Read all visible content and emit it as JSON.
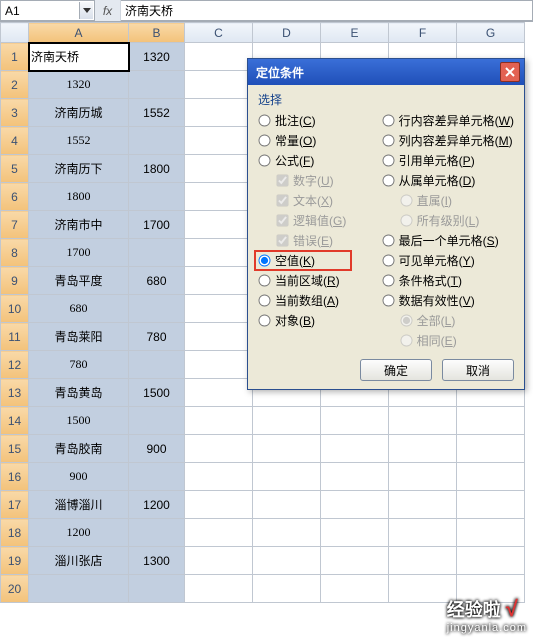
{
  "formula_bar": {
    "name_box": "A1",
    "fx": "fx",
    "value": "济南天桥"
  },
  "columns": [
    "A",
    "B",
    "C",
    "D",
    "E",
    "F",
    "G"
  ],
  "rows": [
    {
      "n": 1,
      "a": "济南天桥",
      "b": "1320"
    },
    {
      "n": 2,
      "a": "1320",
      "b": ""
    },
    {
      "n": 3,
      "a": "济南历城",
      "b": "1552"
    },
    {
      "n": 4,
      "a": "1552",
      "b": ""
    },
    {
      "n": 5,
      "a": "济南历下",
      "b": "1800"
    },
    {
      "n": 6,
      "a": "1800",
      "b": ""
    },
    {
      "n": 7,
      "a": "济南市中",
      "b": "1700"
    },
    {
      "n": 8,
      "a": "1700",
      "b": ""
    },
    {
      "n": 9,
      "a": "青岛平度",
      "b": "680"
    },
    {
      "n": 10,
      "a": "680",
      "b": ""
    },
    {
      "n": 11,
      "a": "青岛莱阳",
      "b": "780"
    },
    {
      "n": 12,
      "a": "780",
      "b": ""
    },
    {
      "n": 13,
      "a": "青岛黄岛",
      "b": "1500"
    },
    {
      "n": 14,
      "a": "1500",
      "b": ""
    },
    {
      "n": 15,
      "a": "青岛胶南",
      "b": "900"
    },
    {
      "n": 16,
      "a": "900",
      "b": ""
    },
    {
      "n": 17,
      "a": "淄博淄川",
      "b": "1200"
    },
    {
      "n": 18,
      "a": "1200",
      "b": ""
    },
    {
      "n": 19,
      "a": "淄川张店",
      "b": "1300"
    },
    {
      "n": 20,
      "a": "",
      "b": ""
    }
  ],
  "dialog": {
    "title": "定位条件",
    "group": "选择",
    "options_left": [
      {
        "type": "radio",
        "label": "批注(C)",
        "checked": false
      },
      {
        "type": "radio",
        "label": "常量(O)",
        "checked": false
      },
      {
        "type": "radio",
        "label": "公式(F)",
        "checked": false
      },
      {
        "type": "check",
        "label": "数字(U)",
        "checked": true,
        "indent": true,
        "disabled": true
      },
      {
        "type": "check",
        "label": "文本(X)",
        "checked": true,
        "indent": true,
        "disabled": true
      },
      {
        "type": "check",
        "label": "逻辑值(G)",
        "checked": true,
        "indent": true,
        "disabled": true
      },
      {
        "type": "check",
        "label": "错误(E)",
        "checked": true,
        "indent": true,
        "disabled": true
      },
      {
        "type": "radio",
        "label": "空值(K)",
        "checked": true,
        "highlight": true
      },
      {
        "type": "radio",
        "label": "当前区域(R)",
        "checked": false
      },
      {
        "type": "radio",
        "label": "当前数组(A)",
        "checked": false
      },
      {
        "type": "radio",
        "label": "对象(B)",
        "checked": false
      }
    ],
    "options_right": [
      {
        "type": "radio",
        "label": "行内容差异单元格(W)",
        "checked": false
      },
      {
        "type": "radio",
        "label": "列内容差异单元格(M)",
        "checked": false
      },
      {
        "type": "radio",
        "label": "引用单元格(P)",
        "checked": false
      },
      {
        "type": "radio",
        "label": "从属单元格(D)",
        "checked": false
      },
      {
        "type": "radio",
        "label": "直属(I)",
        "checked": true,
        "indent": true,
        "disabled": true
      },
      {
        "type": "radio",
        "label": "所有级别(L)",
        "checked": false,
        "indent": true,
        "disabled": true
      },
      {
        "type": "radio",
        "label": "最后一个单元格(S)",
        "checked": false
      },
      {
        "type": "radio",
        "label": "可见单元格(Y)",
        "checked": false
      },
      {
        "type": "radio",
        "label": "条件格式(T)",
        "checked": false
      },
      {
        "type": "radio",
        "label": "数据有效性(V)",
        "checked": false
      },
      {
        "type": "radio",
        "label": "全部(L)",
        "checked": true,
        "indent": true,
        "disabled": true
      },
      {
        "type": "radio",
        "label": "相同(E)",
        "checked": false,
        "indent": true,
        "disabled": true
      }
    ],
    "ok": "确定",
    "cancel": "取消"
  },
  "watermark": {
    "main": "经验啦",
    "sub": "jingyanla.com"
  }
}
